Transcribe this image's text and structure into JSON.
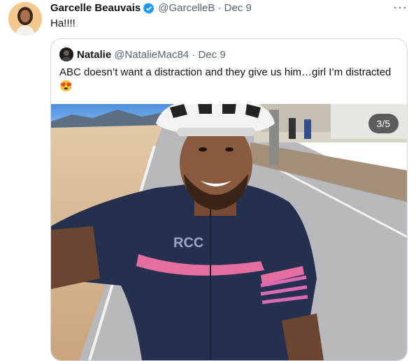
{
  "tweet": {
    "author_name": "Garcelle Beauvais",
    "handle_date": "@GarcelleB · Dec 9",
    "text": "Ha!!!!",
    "more": "···"
  },
  "quoted": {
    "author_name": "Natalie",
    "handle_date": "@NatalieMac84 · Dec 9",
    "text": "ABC doesn’t want a distraction and they give us him…girl I’m distracted",
    "emoji": "😍",
    "photo_counter": "3/5",
    "jersey_text": "RCC"
  },
  "colors": {
    "verified": "#1d9bf0",
    "muted": "#536471",
    "border": "#cfd9de"
  }
}
